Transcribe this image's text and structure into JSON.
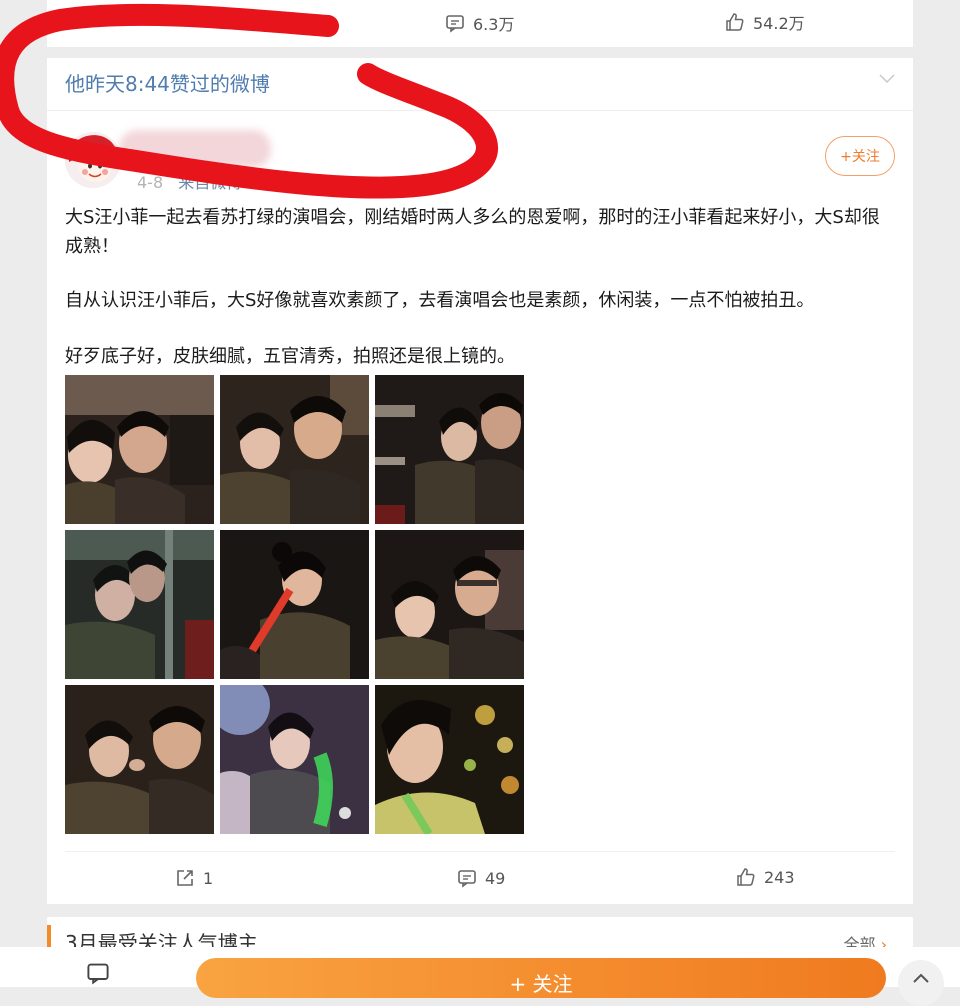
{
  "top_actions": {
    "comments": "6.3万",
    "likes": "54.2万"
  },
  "liked_header": {
    "text": "他昨天8:44赞过的微博"
  },
  "post": {
    "date_partial": "4-8",
    "source": "来自微博 weibo.com",
    "follow_label": "+关注",
    "paragraph1": "大S汪小菲一起去看苏打绿的演唱会，刚结婚时两人多么的恩爱啊，那时的汪小菲看起来好小，大S却很成熟！",
    "paragraph2": "自从认识汪小菲后，大S好像就喜欢素颜了，去看演唱会也是素颜，休闲装，一点不怕被拍丑。",
    "paragraph3": "好歹底子好，皮肤细腻，五官清秀，拍照还是很上镜的。",
    "reposts": "1",
    "comments": "49",
    "likes": "243"
  },
  "next_section": {
    "title": "3月最受关注人气博主",
    "more": "全部"
  },
  "bottom_bar": {
    "follow_label": "+ 关注"
  },
  "colors": {
    "accent": "#f07b2d",
    "link": "#507daf",
    "annotation": "#e8141c"
  }
}
